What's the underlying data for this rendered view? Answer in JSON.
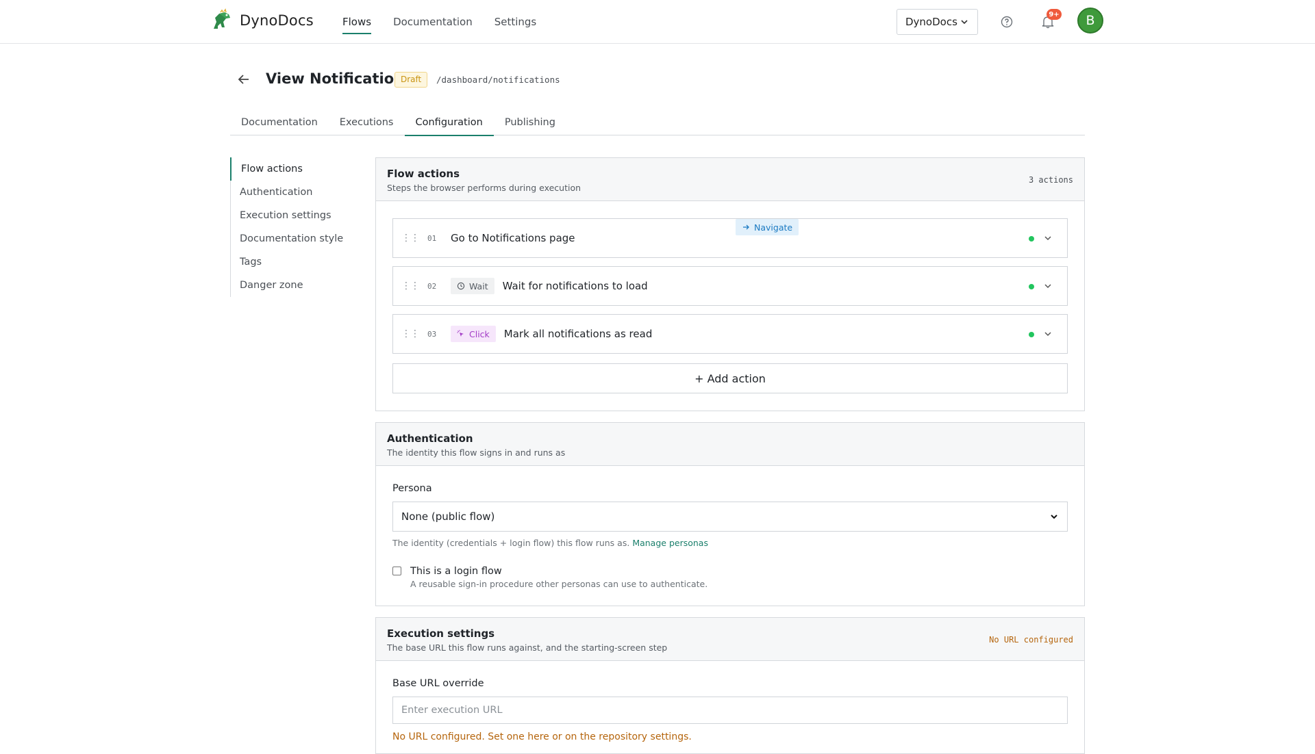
{
  "app": {
    "name": "DynoDocs"
  },
  "nav": {
    "items": [
      "Flows",
      "Documentation",
      "Settings"
    ],
    "active": "Flows"
  },
  "org_selector": {
    "label": "DynoDocs"
  },
  "notifications": {
    "badge": "9+"
  },
  "user": {
    "avatar_initial": "B"
  },
  "page": {
    "title": "View Notifications",
    "status": "Draft",
    "route": "/dashboard/notifications"
  },
  "tabs": [
    "Documentation",
    "Executions",
    "Configuration",
    "Publishing"
  ],
  "active_tab": "Configuration",
  "side": {
    "items": [
      "Flow actions",
      "Authentication",
      "Execution settings",
      "Documentation style",
      "Tags",
      "Danger zone"
    ]
  },
  "flow_actions": {
    "title": "Flow actions",
    "subtitle": "Steps the browser performs during execution",
    "count": "3 actions",
    "items": [
      {
        "num": "01",
        "type": "Navigate",
        "icon": "arrow-right-icon",
        "title": "Go to Notifications page"
      },
      {
        "num": "02",
        "type": "Wait",
        "icon": "clock-icon",
        "title": "Wait for notifications to load"
      },
      {
        "num": "03",
        "type": "Click",
        "icon": "cursor-click-icon",
        "title": "Mark all notifications as read"
      }
    ],
    "add_label": "+ Add action"
  },
  "authentication": {
    "title": "Authentication",
    "subtitle": "The identity this flow signs in and runs as",
    "persona_label": "Persona",
    "persona_value": "None (public flow)",
    "help_text": "The identity (credentials + login flow) this flow runs as.",
    "help_link": "Manage personas",
    "login_flow_label": "This is a login flow",
    "login_flow_desc": "A reusable sign-in procedure other personas can use to authenticate.",
    "login_flow_checked": false
  },
  "execution": {
    "title": "Execution settings",
    "subtitle": "The base URL this flow runs against, and the starting-screen step",
    "status": "No URL configured",
    "base_url_label": "Base URL override",
    "base_url_placeholder": "Enter execution URL",
    "warning": "No URL configured. Set one here or on the repository settings."
  },
  "colors": {
    "accent": "#1a7f6b",
    "status_ok": "#22c55e",
    "warning": "#b5650d",
    "draft": "#c99412"
  }
}
